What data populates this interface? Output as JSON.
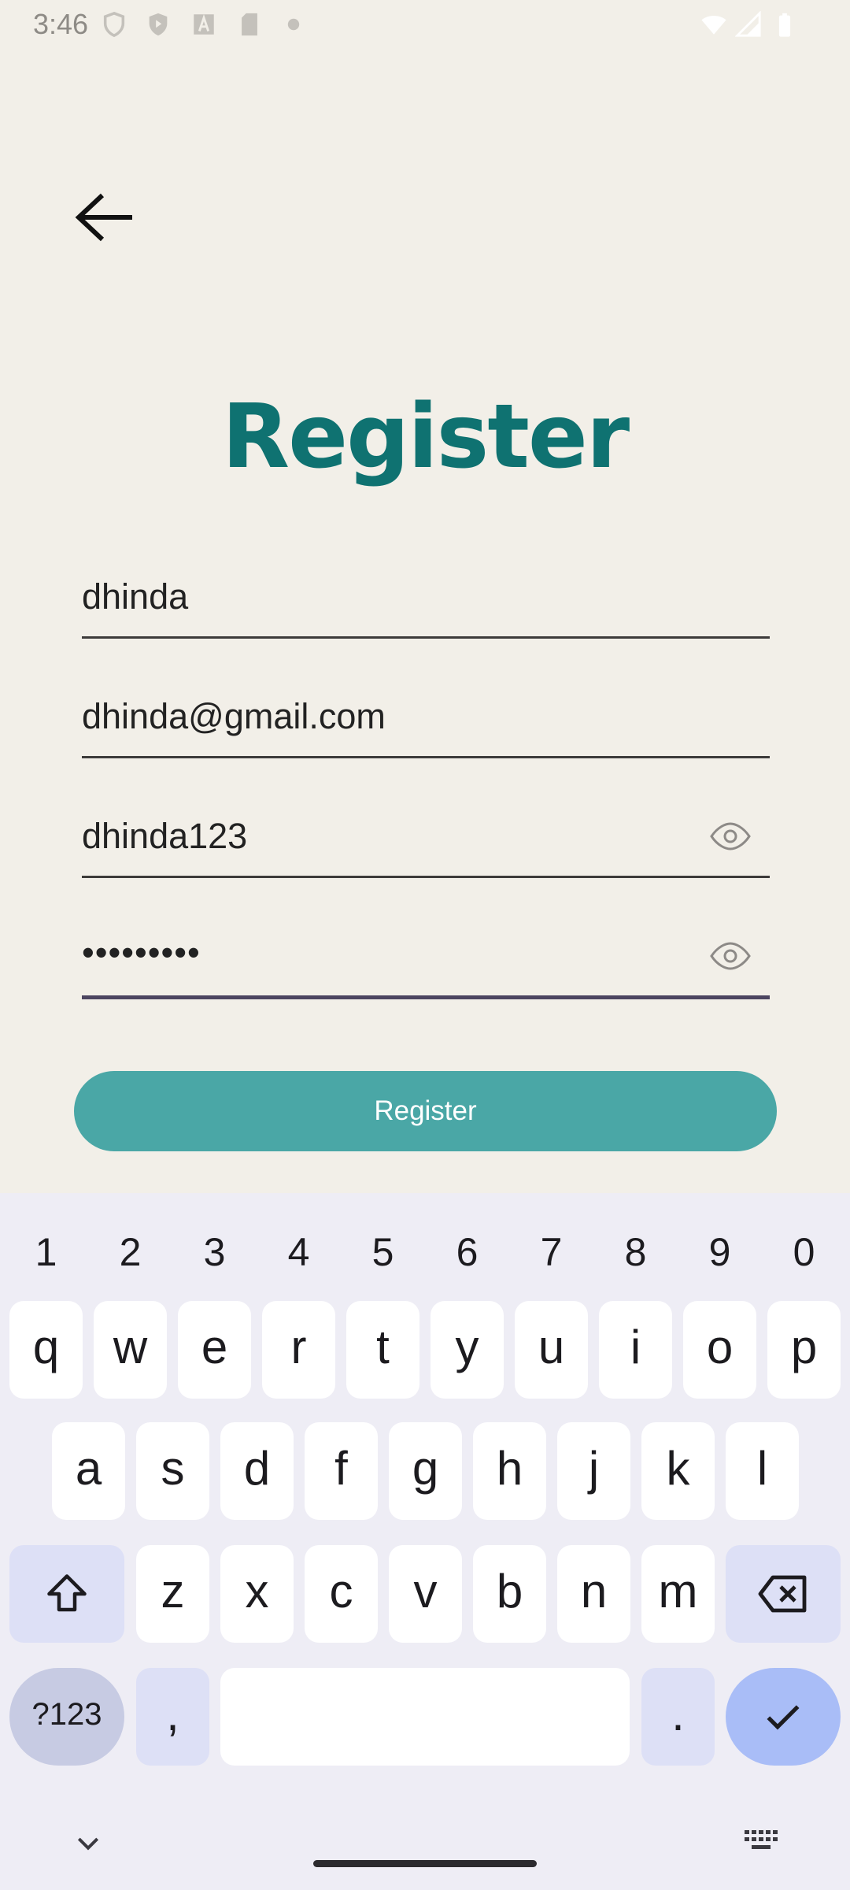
{
  "status_bar": {
    "time": "3:46",
    "left_icons": [
      "shield-icon",
      "play-protect-icon",
      "font-icon",
      "sd-card-icon",
      "dot-icon"
    ],
    "right_icons": [
      "wifi-icon",
      "signal-icon",
      "battery-icon"
    ]
  },
  "app": {
    "back_icon": "arrow-back-icon",
    "title": "Register",
    "fields": {
      "username": "dhinda",
      "email": "dhinda@gmail.com",
      "password": "dhinda123",
      "confirm_password_masked": "•••••••••"
    },
    "register_button": "Register",
    "colors": {
      "accent": "#0f7271",
      "button": "#4aa7a6",
      "background": "#f2efe8"
    }
  },
  "keyboard": {
    "numbers": [
      "1",
      "2",
      "3",
      "4",
      "5",
      "6",
      "7",
      "8",
      "9",
      "0"
    ],
    "row1": [
      "q",
      "w",
      "e",
      "r",
      "t",
      "y",
      "u",
      "i",
      "o",
      "p"
    ],
    "row2": [
      "a",
      "s",
      "d",
      "f",
      "g",
      "h",
      "j",
      "k",
      "l"
    ],
    "row3": [
      "z",
      "x",
      "c",
      "v",
      "b",
      "n",
      "m"
    ],
    "symbols_key": "?123",
    "comma": ",",
    "period": "."
  }
}
